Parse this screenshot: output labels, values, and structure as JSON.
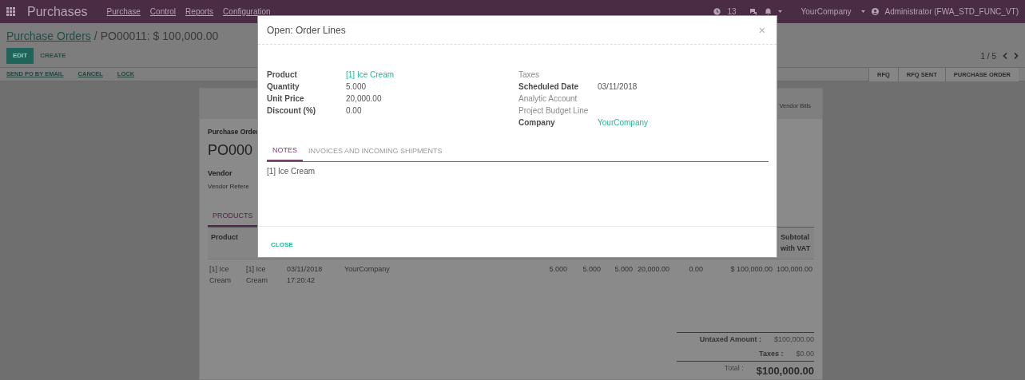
{
  "navbar": {
    "app_title": "Purchases",
    "menus": [
      "Purchase",
      "Control",
      "Reports",
      "Configuration"
    ],
    "activity_count": "13",
    "company": "YourCompany",
    "user": "Administrator (FWA_STD_FUNC_VT)"
  },
  "breadcrumb": {
    "parent": "Purchase Orders",
    "separator": "/",
    "current": "PO00011: $ 100,000.00"
  },
  "actions": [
    {
      "label": "EDIT",
      "kind": "primary"
    },
    {
      "label": "CREATE",
      "kind": "link"
    }
  ],
  "pager": "1 / 5",
  "status_buttons": [
    "SEND PO BY EMAIL",
    "CANCEL",
    "LOCK"
  ],
  "stages": [
    "RFQ",
    "RFQ SENT",
    "PURCHASE ORDER"
  ],
  "sheet": {
    "smart_button": "Vendor Bills",
    "subtitle": "Purchase Order",
    "name": "PO000",
    "vendor_label": "Vendor",
    "vendor_reference_label": "Vendor Refere",
    "tab": "PRODUCTS",
    "header": {
      "first": "Product",
      "last": "Subtotal with VAT"
    },
    "row": [
      "[1] Ice Cream",
      "[1] Ice Cream",
      "03/11/2018 17:20:42",
      "YourCompany",
      "5.000",
      "5.000",
      "5.000",
      "20,000.00",
      "0.00",
      "$ 100,000.00",
      "100,000.00"
    ],
    "totals": [
      {
        "label": "Untaxed Amount :",
        "value": "$100,000.00",
        "kind": "line"
      },
      {
        "label": "Taxes :",
        "value": "$0.00",
        "kind": "line"
      },
      {
        "label": "Total :",
        "value": "$100,000.00",
        "kind": "grand"
      }
    ]
  },
  "modal": {
    "title": "Open: Order Lines",
    "close_icon": "×",
    "left_fields": [
      {
        "label": "Product",
        "value": "[1] Ice Cream",
        "required": true,
        "link": true
      },
      {
        "label": "Quantity",
        "value": "5.000",
        "required": true,
        "link": false
      },
      {
        "label": "Unit Price",
        "value": "20,000.00",
        "required": true,
        "link": false
      },
      {
        "label": "Discount (%)",
        "value": "0.00",
        "required": true,
        "link": false
      }
    ],
    "right_fields": [
      {
        "label": "Taxes",
        "required": false
      },
      {
        "label": "Scheduled Date",
        "value": "03/11/2018",
        "required": true,
        "link": false
      },
      {
        "label": "Analytic Account",
        "required": false
      },
      {
        "label": "Project Budget Line",
        "required": false
      },
      {
        "label": "Company",
        "value": "YourCompany",
        "required": true,
        "link": true
      }
    ],
    "tabs": [
      {
        "label": "NOTES",
        "selected": true
      },
      {
        "label": "INVOICES AND INCOMING SHIPMENTS",
        "selected": false
      }
    ],
    "note": "[1] Ice Cream",
    "footer_button": "CLOSE"
  }
}
